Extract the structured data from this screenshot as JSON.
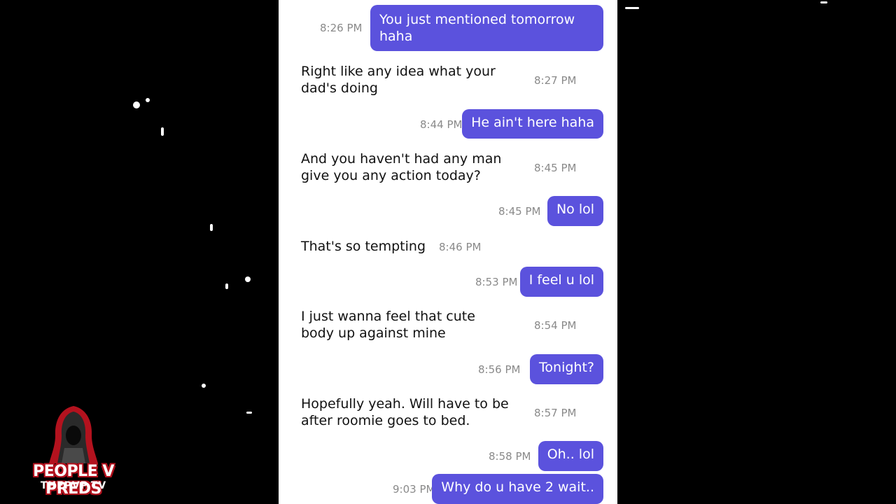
{
  "conversation": {
    "messages": [
      {
        "direction": "outgoing",
        "text": "You just mentioned tomorrow haha",
        "time": "8:26 PM"
      },
      {
        "direction": "incoming",
        "text": "Right like any idea what your dad's doing",
        "time": "8:27 PM"
      },
      {
        "direction": "outgoing",
        "text": "He ain't here haha",
        "time": "8:44 PM"
      },
      {
        "direction": "incoming",
        "text": "And you haven't had any man give you any action today?",
        "time": "8:45 PM"
      },
      {
        "direction": "outgoing",
        "text": "No lol",
        "time": "8:45 PM"
      },
      {
        "direction": "incoming",
        "text": "That's so tempting",
        "time": "8:46 PM"
      },
      {
        "direction": "outgoing",
        "text": "I feel u lol",
        "time": "8:53 PM"
      },
      {
        "direction": "incoming",
        "text": "I just wanna feel that cute body up against mine",
        "time": "8:54 PM"
      },
      {
        "direction": "outgoing",
        "text": "Tonight?",
        "time": "8:56 PM"
      },
      {
        "direction": "incoming",
        "text": "Hopefully yeah. Will have to be after roomie goes to bed.",
        "time": "8:57 PM"
      },
      {
        "direction": "outgoing",
        "text": "Oh.. lol",
        "time": "8:58 PM"
      },
      {
        "direction": "outgoing",
        "text": "Why do u have 2 wait..",
        "time": "9:03 PM"
      }
    ],
    "colors": {
      "outgoing_bubble": "#5b52dd",
      "outgoing_text": "#ffffff",
      "incoming_text": "#111111",
      "timestamp": "#8a8a8a",
      "background": "#ffffff"
    }
  },
  "watermark": {
    "title": "PEOPLE V PREDS",
    "subtitle": "THEPVP.TV",
    "icon": "hooded-figure-icon",
    "accent_color": "#b3121e"
  }
}
